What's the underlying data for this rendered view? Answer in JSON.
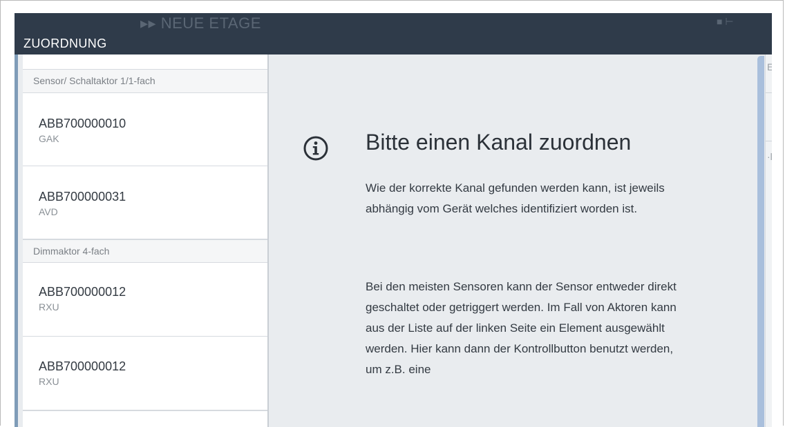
{
  "header": {
    "title": "ZUORDNUNG",
    "background_title": "▸▸ NEUE ETAGE"
  },
  "list": {
    "groups": [
      {
        "label": "Sensor/ Schaltaktor 1/1-fach",
        "items": [
          {
            "id": "ABB700000010",
            "type": "GAK"
          },
          {
            "id": "ABB700000031",
            "type": "AVD"
          }
        ]
      },
      {
        "label": "Dimmaktor 4-fach",
        "items": [
          {
            "id": "ABB700000012",
            "type": "RXU"
          },
          {
            "id": "ABB700000012",
            "type": "RXU"
          }
        ]
      }
    ]
  },
  "detail": {
    "icon": "info-icon",
    "title": "Bitte einen Kanal zuordnen",
    "paragraph1": "Wie der korrekte Kanal gefunden werden kann, ist jeweils abhängig vom Gerät welches identifiziert worden ist.",
    "paragraph2": "Bei den meisten Sensoren kann der Sensor entweder direkt geschaltet oder getriggert werden. Im Fall von Aktoren kann aus der Liste auf der linken Seite ein Element ausgewählt werden. Hier kann dann der Kontrollbutton benutzt werden, um z.B. eine"
  },
  "colors": {
    "header_bg": "#2f3b4a",
    "panel_bg": "#e9ecef",
    "accent": "#7f9cb8",
    "scrollbar": "#a9bfdc"
  }
}
